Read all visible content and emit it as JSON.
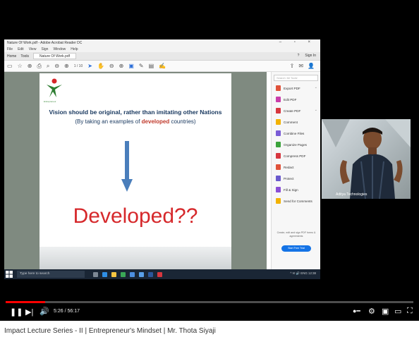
{
  "pdf_window": {
    "title": "Nature Of Work.pdf - Adobe Acrobat Reader DC",
    "window_controls": "– ▫ ×",
    "menu": [
      "File",
      "Edit",
      "View",
      "Sign",
      "Window",
      "Help"
    ],
    "tabs": [
      "Home",
      "Tools",
      "Nature Of Work.pdf"
    ],
    "account": [
      "Sign In"
    ],
    "page_indicator": "1 / 10"
  },
  "slide": {
    "logo_text": "Entrepreneur",
    "heading": "Vision should be original, rather than imitating other Nations",
    "subline_before": "(By taking an examples of ",
    "subline_highlight": "developed",
    "subline_after": " countries)",
    "big_word": "Developed??"
  },
  "side_panel": {
    "search_placeholder": "Search 'All Tools'",
    "items": [
      {
        "label": "Export PDF",
        "color": "#e0533b"
      },
      {
        "label": "Edit PDF",
        "color": "#c93daa"
      },
      {
        "label": "Create PDF",
        "color": "#d7373f"
      },
      {
        "label": "Comment",
        "color": "#f2b200"
      },
      {
        "label": "Combine Files",
        "color": "#7a5cd6"
      },
      {
        "label": "Organize Pages",
        "color": "#3ca33c"
      },
      {
        "label": "Compress PDF",
        "color": "#d7373f"
      },
      {
        "label": "Redact",
        "color": "#e0533b"
      },
      {
        "label": "Protect",
        "color": "#6a5acd"
      },
      {
        "label": "Fill & Sign",
        "color": "#8a4fd6"
      },
      {
        "label": "Send for Comments",
        "color": "#f2b200"
      }
    ],
    "promo": "Create, edit and sign PDF forms & agreements",
    "cta": "Start Free Trial"
  },
  "taskbar": {
    "search_placeholder": "Type here to search",
    "tray_time": "^ ✉ 🔊 ENG 12:38"
  },
  "webcam": {
    "label": "Aditya Technologies"
  },
  "player": {
    "time": "5:26 / 56:17",
    "progress": 0.097
  },
  "video_title": "Impact Lecture Series - II | Entrepreneur's Mindset | Mr. Thota Siyaji"
}
